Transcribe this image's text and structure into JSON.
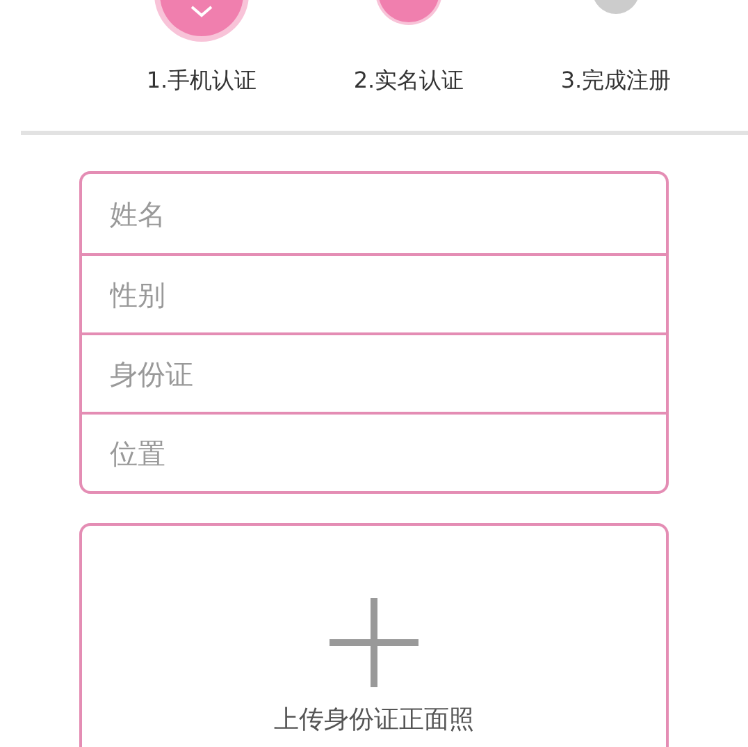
{
  "steps": [
    {
      "label": "1.手机认证",
      "kind": "done"
    },
    {
      "label": "2.实名认证",
      "kind": "current"
    },
    {
      "label": "3.完成注册",
      "kind": "pending"
    }
  ],
  "fields": [
    {
      "placeholder": "姓名"
    },
    {
      "placeholder": "性别"
    },
    {
      "placeholder": "身份证"
    },
    {
      "placeholder": "位置"
    }
  ],
  "upload": {
    "label": "上传身份证正面照"
  }
}
